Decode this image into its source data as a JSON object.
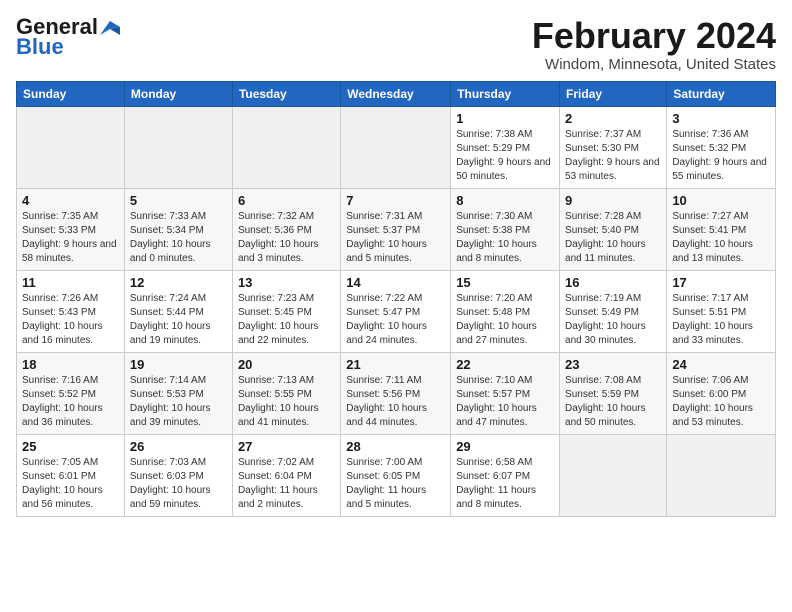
{
  "logo": {
    "general": "General",
    "blue": "Blue"
  },
  "title": "February 2024",
  "subtitle": "Windom, Minnesota, United States",
  "headers": [
    "Sunday",
    "Monday",
    "Tuesday",
    "Wednesday",
    "Thursday",
    "Friday",
    "Saturday"
  ],
  "weeks": [
    [
      {
        "num": "",
        "info": ""
      },
      {
        "num": "",
        "info": ""
      },
      {
        "num": "",
        "info": ""
      },
      {
        "num": "",
        "info": ""
      },
      {
        "num": "1",
        "info": "Sunrise: 7:38 AM\nSunset: 5:29 PM\nDaylight: 9 hours and 50 minutes."
      },
      {
        "num": "2",
        "info": "Sunrise: 7:37 AM\nSunset: 5:30 PM\nDaylight: 9 hours and 53 minutes."
      },
      {
        "num": "3",
        "info": "Sunrise: 7:36 AM\nSunset: 5:32 PM\nDaylight: 9 hours and 55 minutes."
      }
    ],
    [
      {
        "num": "4",
        "info": "Sunrise: 7:35 AM\nSunset: 5:33 PM\nDaylight: 9 hours and 58 minutes."
      },
      {
        "num": "5",
        "info": "Sunrise: 7:33 AM\nSunset: 5:34 PM\nDaylight: 10 hours and 0 minutes."
      },
      {
        "num": "6",
        "info": "Sunrise: 7:32 AM\nSunset: 5:36 PM\nDaylight: 10 hours and 3 minutes."
      },
      {
        "num": "7",
        "info": "Sunrise: 7:31 AM\nSunset: 5:37 PM\nDaylight: 10 hours and 5 minutes."
      },
      {
        "num": "8",
        "info": "Sunrise: 7:30 AM\nSunset: 5:38 PM\nDaylight: 10 hours and 8 minutes."
      },
      {
        "num": "9",
        "info": "Sunrise: 7:28 AM\nSunset: 5:40 PM\nDaylight: 10 hours and 11 minutes."
      },
      {
        "num": "10",
        "info": "Sunrise: 7:27 AM\nSunset: 5:41 PM\nDaylight: 10 hours and 13 minutes."
      }
    ],
    [
      {
        "num": "11",
        "info": "Sunrise: 7:26 AM\nSunset: 5:43 PM\nDaylight: 10 hours and 16 minutes."
      },
      {
        "num": "12",
        "info": "Sunrise: 7:24 AM\nSunset: 5:44 PM\nDaylight: 10 hours and 19 minutes."
      },
      {
        "num": "13",
        "info": "Sunrise: 7:23 AM\nSunset: 5:45 PM\nDaylight: 10 hours and 22 minutes."
      },
      {
        "num": "14",
        "info": "Sunrise: 7:22 AM\nSunset: 5:47 PM\nDaylight: 10 hours and 24 minutes."
      },
      {
        "num": "15",
        "info": "Sunrise: 7:20 AM\nSunset: 5:48 PM\nDaylight: 10 hours and 27 minutes."
      },
      {
        "num": "16",
        "info": "Sunrise: 7:19 AM\nSunset: 5:49 PM\nDaylight: 10 hours and 30 minutes."
      },
      {
        "num": "17",
        "info": "Sunrise: 7:17 AM\nSunset: 5:51 PM\nDaylight: 10 hours and 33 minutes."
      }
    ],
    [
      {
        "num": "18",
        "info": "Sunrise: 7:16 AM\nSunset: 5:52 PM\nDaylight: 10 hours and 36 minutes."
      },
      {
        "num": "19",
        "info": "Sunrise: 7:14 AM\nSunset: 5:53 PM\nDaylight: 10 hours and 39 minutes."
      },
      {
        "num": "20",
        "info": "Sunrise: 7:13 AM\nSunset: 5:55 PM\nDaylight: 10 hours and 41 minutes."
      },
      {
        "num": "21",
        "info": "Sunrise: 7:11 AM\nSunset: 5:56 PM\nDaylight: 10 hours and 44 minutes."
      },
      {
        "num": "22",
        "info": "Sunrise: 7:10 AM\nSunset: 5:57 PM\nDaylight: 10 hours and 47 minutes."
      },
      {
        "num": "23",
        "info": "Sunrise: 7:08 AM\nSunset: 5:59 PM\nDaylight: 10 hours and 50 minutes."
      },
      {
        "num": "24",
        "info": "Sunrise: 7:06 AM\nSunset: 6:00 PM\nDaylight: 10 hours and 53 minutes."
      }
    ],
    [
      {
        "num": "25",
        "info": "Sunrise: 7:05 AM\nSunset: 6:01 PM\nDaylight: 10 hours and 56 minutes."
      },
      {
        "num": "26",
        "info": "Sunrise: 7:03 AM\nSunset: 6:03 PM\nDaylight: 10 hours and 59 minutes."
      },
      {
        "num": "27",
        "info": "Sunrise: 7:02 AM\nSunset: 6:04 PM\nDaylight: 11 hours and 2 minutes."
      },
      {
        "num": "28",
        "info": "Sunrise: 7:00 AM\nSunset: 6:05 PM\nDaylight: 11 hours and 5 minutes."
      },
      {
        "num": "29",
        "info": "Sunrise: 6:58 AM\nSunset: 6:07 PM\nDaylight: 11 hours and 8 minutes."
      },
      {
        "num": "",
        "info": ""
      },
      {
        "num": "",
        "info": ""
      }
    ]
  ]
}
